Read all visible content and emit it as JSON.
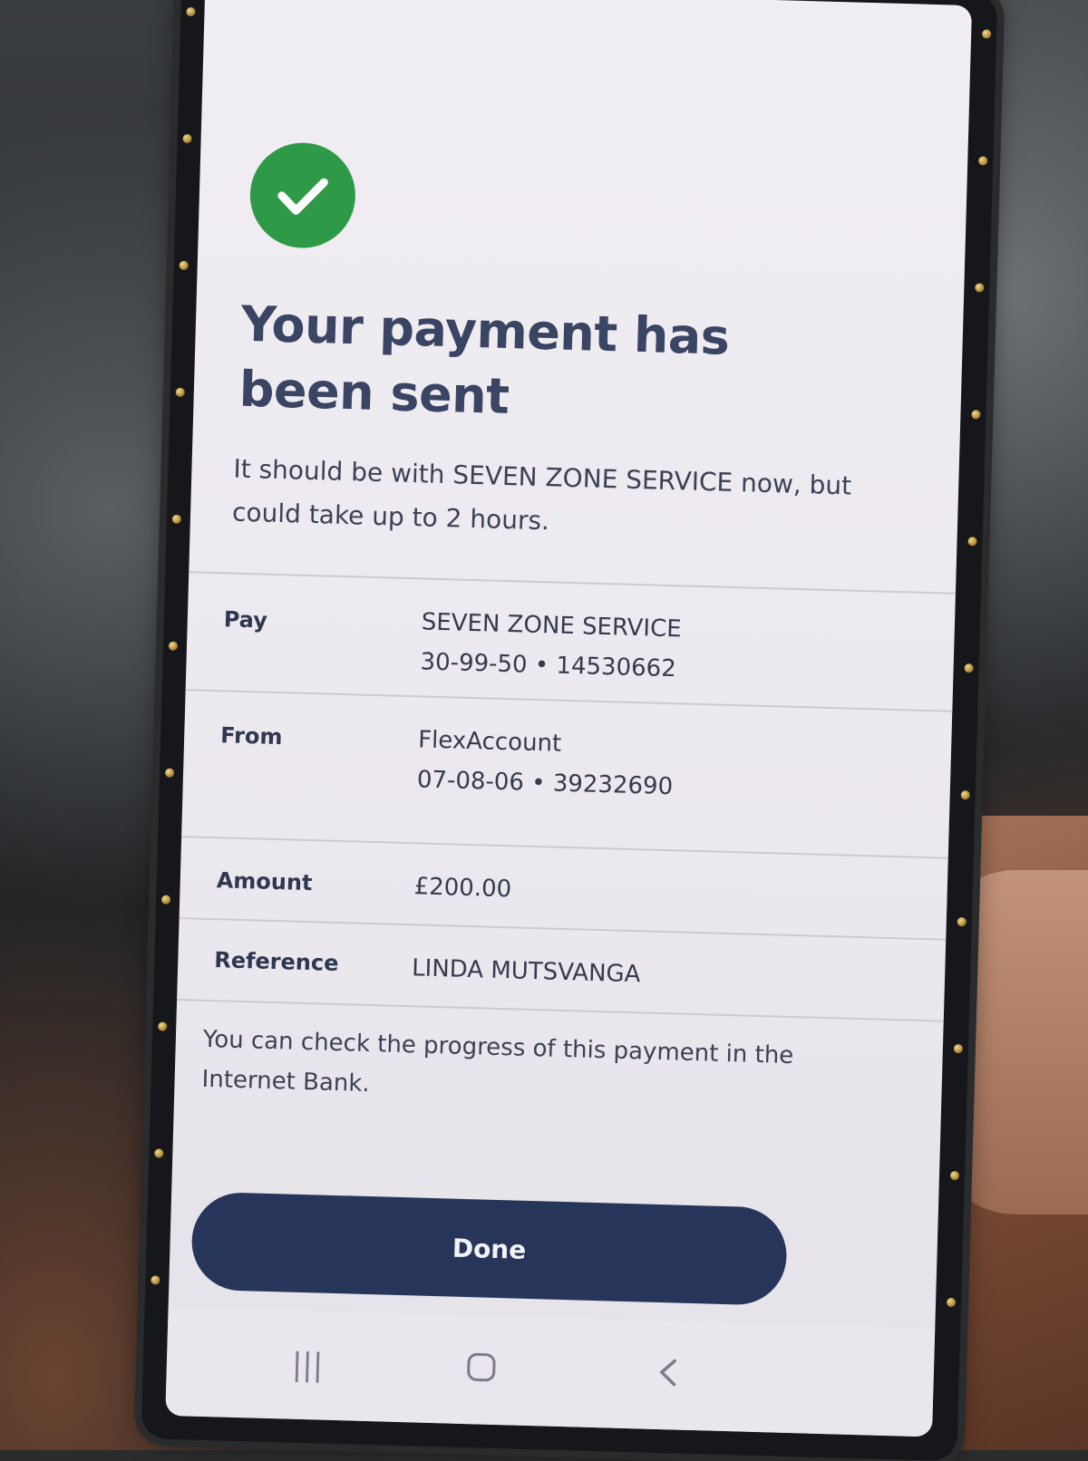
{
  "confirmation": {
    "title": "Your payment has been sent",
    "subtitle": "It should be with SEVEN ZONE SERVICE now, but could take up to 2 hours."
  },
  "details": [
    {
      "label": "Pay",
      "line1": "SEVEN ZONE SERVICE",
      "line2": "30-99-50 • 14530662"
    },
    {
      "label": "From",
      "line1": "FlexAccount",
      "line2": "07-08-06 • 39232690"
    },
    {
      "label": "Amount",
      "line1": "£200.00",
      "line2": ""
    },
    {
      "label": "Reference",
      "line1": "LINDA MUTSVANGA",
      "line2": ""
    }
  ],
  "note": "You can check the progress of this payment in the Internet Bank.",
  "actions": {
    "done_label": "Done"
  },
  "navbar": {
    "recents_icon": "recents-icon",
    "home_icon": "home-icon",
    "back_icon": "back-icon"
  },
  "colors": {
    "success": "#2e9a47",
    "primary_button": "#27355a",
    "heading": "#3a4463"
  }
}
